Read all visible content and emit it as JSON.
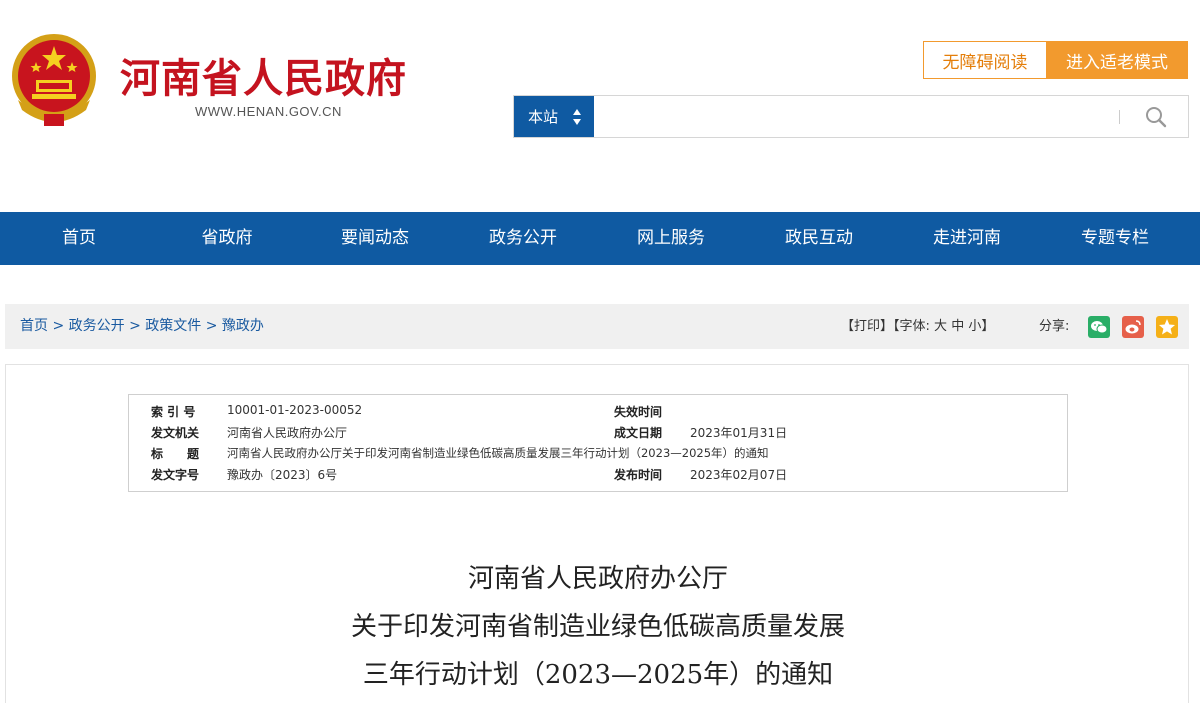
{
  "header": {
    "site_title": "河南省人民政府",
    "site_domain": "WWW.HENAN.GOV.CN",
    "accessible_label": "无障碍阅读",
    "elder_mode_label": "进入适老模式",
    "search": {
      "scope": "本站",
      "value": "",
      "placeholder": ""
    }
  },
  "nav": {
    "items": [
      "首页",
      "省政府",
      "要闻动态",
      "政务公开",
      "网上服务",
      "政民互动",
      "走进河南",
      "专题专栏"
    ]
  },
  "breadcrumb": [
    "首页",
    "政务公开",
    "政策文件",
    "豫政办"
  ],
  "tools": {
    "print": "【打印】",
    "font_prefix": "【字体:",
    "font_large": "大",
    "font_medium": "中",
    "font_small": "小",
    "font_suffix": "】",
    "share_label": "分享:"
  },
  "meta": {
    "index_label": "索 引 号",
    "index_value": "10001-01-2023-00052",
    "expire_label": "失效时间",
    "expire_value": "",
    "issuer_label": "发文机关",
    "issuer_value": "河南省人民政府办公厅",
    "created_label": "成文日期",
    "created_value": "2023年01月31日",
    "title_label": "标　　题",
    "title_value": "河南省人民政府办公厅关于印发河南省制造业绿色低碳高质量发展三年行动计划（2023—2025年）的通知",
    "docno_label": "发文字号",
    "docno_value": "豫政办〔2023〕6号",
    "published_label": "发布时间",
    "published_value": "2023年02月07日"
  },
  "document": {
    "title_line1": "河南省人民政府办公厅",
    "title_line2": "关于印发河南省制造业绿色低碳高质量发展",
    "title_line3": "三年行动计划（2023—2025年）的通知"
  },
  "colors": {
    "brand_red": "#c4131f",
    "nav_blue": "#0f5aa2",
    "accent_orange": "#f29a2e",
    "wechat_green": "#2aae67",
    "weibo_red": "#e6604a",
    "favorite_yellow": "#f5b018"
  }
}
